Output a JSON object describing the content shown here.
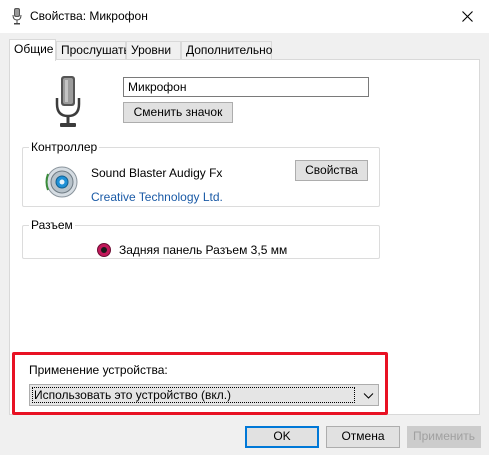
{
  "window": {
    "title": "Свойства: Микрофон"
  },
  "tabs": [
    {
      "label": "Общие",
      "active": true
    },
    {
      "label": "Прослушать",
      "active": false
    },
    {
      "label": "Уровни",
      "active": false
    },
    {
      "label": "Дополнительно",
      "active": false
    }
  ],
  "general": {
    "device_name": "Микрофон",
    "change_icon_label": "Сменить значок"
  },
  "controller": {
    "group_label": "Контроллер",
    "name": "Sound Blaster Audigy Fx",
    "vendor": "Creative Technology Ltd.",
    "properties_label": "Свойства"
  },
  "jack": {
    "group_label": "Разъем",
    "description": "Задняя панель Разъем 3,5 мм",
    "jack_color": "#c2185b"
  },
  "usage": {
    "label": "Применение устройства:",
    "selected": "Использовать это устройство (вкл.)",
    "highlight_color": "#e81123"
  },
  "footer": {
    "ok_label": "OK",
    "cancel_label": "Отмена",
    "apply_label": "Применить",
    "apply_enabled": false
  },
  "icons": {
    "title": "microphone-icon",
    "device": "microphone-icon",
    "controller": "speaker-icon",
    "jack": "audio-jack-icon",
    "close": "close-icon",
    "dropdown": "chevron-down-icon"
  }
}
